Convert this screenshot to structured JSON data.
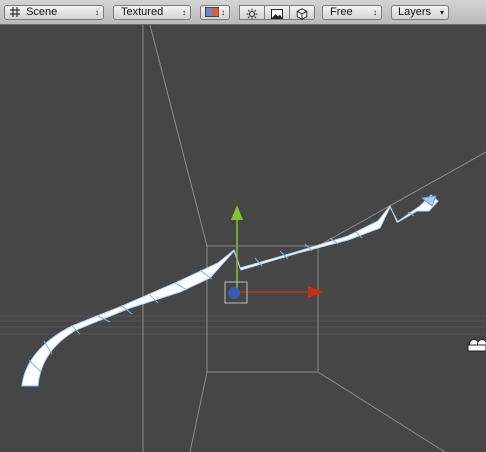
{
  "toolbar": {
    "draw_mode": "Scene",
    "render_mode": "Textured",
    "camera_mode": "Free",
    "layers_label": "Layers",
    "dropdown_arrow": "↕",
    "layers_arrow": "▾"
  },
  "colors": {
    "viewport_bg": "#464646",
    "toolbar_bg": "#c8c8c8",
    "grid_line": "#8a8a8a",
    "mesh_fill": "#ffffff",
    "mesh_wire": "#7fb2e8",
    "y_axis": "#7ec33a",
    "x_axis": "#c0321a",
    "center_handle": "#3a59b5"
  },
  "icons": [
    "grid-icon",
    "color-swatch-icon",
    "sun-lighting-icon",
    "image-fx-icon",
    "cube-gizmo-icon",
    "camera-icon"
  ]
}
